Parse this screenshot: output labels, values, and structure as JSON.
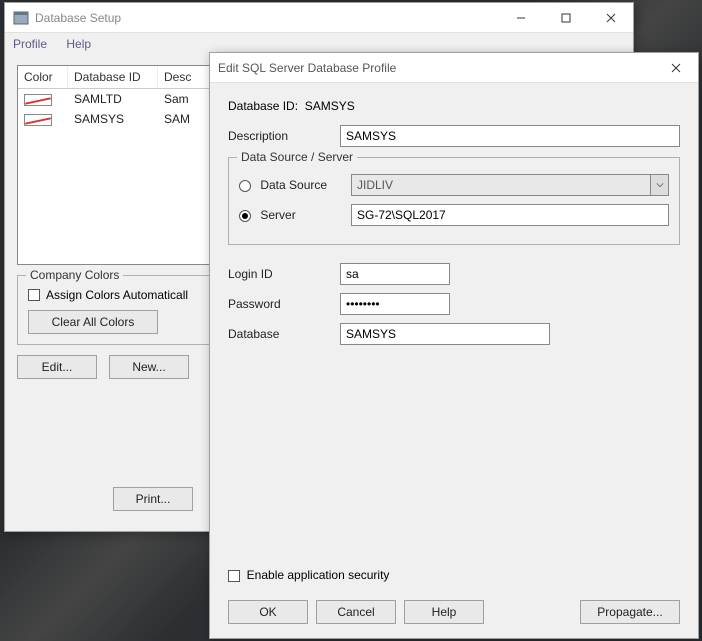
{
  "main": {
    "title": "Database Setup",
    "menu": {
      "profile": "Profile",
      "help": "Help"
    },
    "grid": {
      "headers": {
        "color": "Color",
        "db_id": "Database ID",
        "desc": "Desc"
      },
      "rows": [
        {
          "db_id": "SAMLTD",
          "desc": "Sam"
        },
        {
          "db_id": "SAMSYS",
          "desc": "SAM"
        }
      ]
    },
    "company_colors": {
      "legend": "Company Colors",
      "assign": "Assign Colors Automaticall",
      "clear": "Clear All Colors"
    },
    "buttons": {
      "edit": "Edit...",
      "new": "New...",
      "print": "Print..."
    }
  },
  "dialog": {
    "title": "Edit SQL Server Database Profile",
    "db_id_label": "Database ID:",
    "db_id_value": "SAMSYS",
    "desc_label": "Description",
    "desc_value": "SAMSYS",
    "ds_legend": "Data Source / Server",
    "ds_label": "Data Source",
    "ds_value": "JIDLIV",
    "server_label": "Server",
    "server_value": "SG-72\\SQL2017",
    "login_label": "Login ID",
    "login_value": "sa",
    "pw_label": "Password",
    "pw_value": "••••••••",
    "database_label": "Database",
    "database_value": "SAMSYS",
    "enable_security": "Enable application security",
    "buttons": {
      "ok": "OK",
      "cancel": "Cancel",
      "help": "Help",
      "propagate": "Propagate..."
    }
  }
}
